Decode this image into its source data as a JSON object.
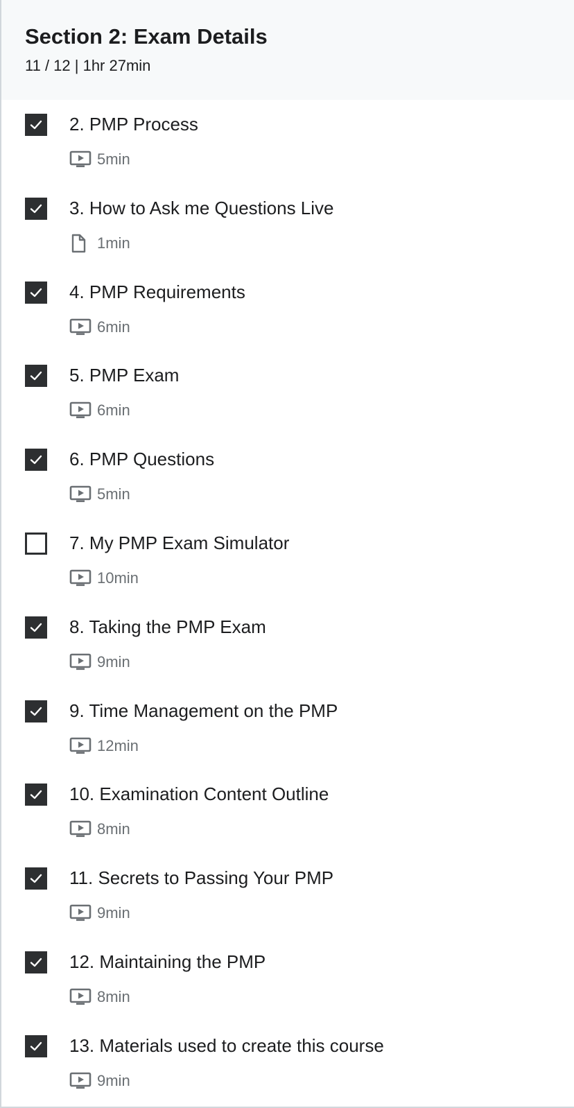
{
  "section": {
    "title": "Section 2: Exam Details",
    "meta": "11 / 12 | 1hr 27min"
  },
  "colors": {
    "header_bg": "#f7f9fa",
    "checkbox": "#2d2f31",
    "meta_text": "#6a6f73"
  },
  "items": [
    {
      "title": "2. PMP Process",
      "duration": "5min",
      "icon": "video-icon",
      "checked": true
    },
    {
      "title": "3. How to Ask me Questions Live",
      "duration": "1min",
      "icon": "file-icon",
      "checked": true
    },
    {
      "title": "4. PMP Requirements",
      "duration": "6min",
      "icon": "video-icon",
      "checked": true
    },
    {
      "title": "5. PMP Exam",
      "duration": "6min",
      "icon": "video-icon",
      "checked": true
    },
    {
      "title": "6. PMP Questions",
      "duration": "5min",
      "icon": "video-icon",
      "checked": true
    },
    {
      "title": "7. My PMP Exam Simulator",
      "duration": "10min",
      "icon": "video-icon",
      "checked": false
    },
    {
      "title": "8. Taking the PMP Exam",
      "duration": "9min",
      "icon": "video-icon",
      "checked": true
    },
    {
      "title": "9. Time Management on the PMP",
      "duration": "12min",
      "icon": "video-icon",
      "checked": true
    },
    {
      "title": "10. Examination Content Outline",
      "duration": "8min",
      "icon": "video-icon",
      "checked": true
    },
    {
      "title": "11. Secrets to Passing Your PMP",
      "duration": "9min",
      "icon": "video-icon",
      "checked": true
    },
    {
      "title": "12. Maintaining the PMP",
      "duration": "8min",
      "icon": "video-icon",
      "checked": true
    },
    {
      "title": "13. Materials used to create this course",
      "duration": "9min",
      "icon": "video-icon",
      "checked": true
    }
  ]
}
